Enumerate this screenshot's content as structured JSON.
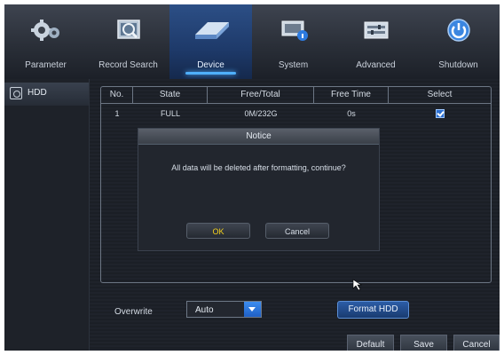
{
  "nav": {
    "items": [
      {
        "label": "Parameter",
        "icon": "gears-icon"
      },
      {
        "label": "Record Search",
        "icon": "magnifier-icon"
      },
      {
        "label": "Device",
        "icon": "hard-drive-icon"
      },
      {
        "label": "System",
        "icon": "monitor-info-icon"
      },
      {
        "label": "Advanced",
        "icon": "panel-icon"
      },
      {
        "label": "Shutdown",
        "icon": "power-icon"
      }
    ],
    "active": "Device"
  },
  "sidebar": {
    "items": [
      {
        "label": "HDD",
        "icon": "hdd-icon"
      }
    ]
  },
  "table": {
    "headers": [
      "No.",
      "State",
      "Free/Total",
      "Free Time",
      "Select"
    ],
    "rows": [
      {
        "no": "1",
        "state": "FULL",
        "free_total": "0M/232G",
        "free_time": "0s",
        "selected": true
      }
    ]
  },
  "dialog": {
    "title": "Notice",
    "message": "All data will be deleted after formatting, continue?",
    "ok_label": "OK",
    "cancel_label": "Cancel"
  },
  "controls": {
    "overwrite_label": "Overwrite",
    "overwrite_value": "Auto",
    "format_label": "Format HDD"
  },
  "footer": {
    "default_label": "Default",
    "save_label": "Save",
    "cancel_label": "Cancel"
  },
  "colors": {
    "accent": "#4fb0ff",
    "ok_text": "#f6d21c",
    "active_tab": "#1e3a6a"
  }
}
